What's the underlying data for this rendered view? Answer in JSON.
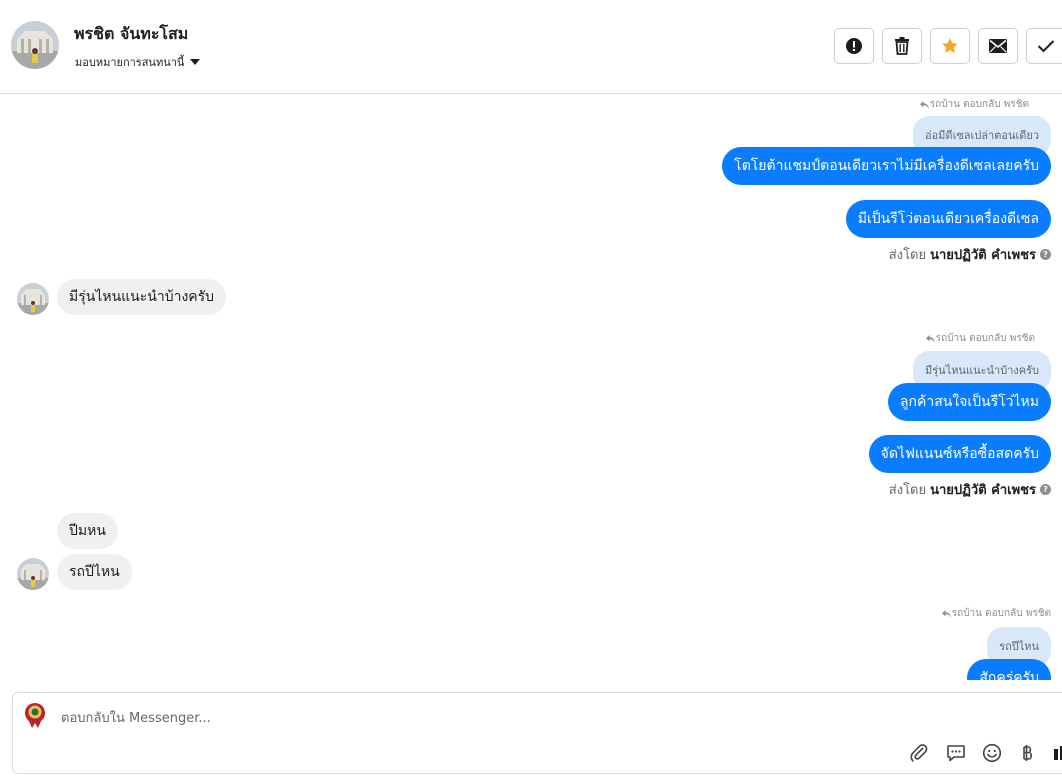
{
  "header": {
    "contact_name": "พรชิต จันทะโสม",
    "assign_label": "มอบหมายการสนทนานี้",
    "actions": [
      "mark-spam",
      "delete",
      "star",
      "mark-unread",
      "done"
    ],
    "star_color": "#f5a623"
  },
  "messages": {
    "reply1": {
      "meta": "รถบ้าน ตอบกลับ พรชิต",
      "quoted": "อ่อมีดีเซลเปล่าตอนเดียว",
      "bubbles": [
        "โตโยต้าแชมป์ตอนเดียวเราไม่มีเครื่องดีเซลเลยครับ",
        "มีเป็นรีโว่ตอนเดียวเครื่องดีเซล"
      ],
      "sent_prefix": "ส่งโดย",
      "sent_by": "นายปฏิวัติ คำเพชร"
    },
    "incoming1": "มีรุ่นไหนแนะนำบ้างครับ",
    "reply2": {
      "meta": "รถบ้าน ตอบกลับ พรชิต",
      "quoted": "มีรุ่นไหนแนะนำบ้างครับ",
      "bubbles": [
        "ลูกค้าสนใจเป็นรีโว่ไหม",
        "จัดไฟแนนซ์หรือซื้อสดครับ"
      ],
      "sent_prefix": "ส่งโดย",
      "sent_by": "นายปฏิวัติ คำเพชร"
    },
    "incoming2": [
      "ปีมหน",
      "รถปีไหน"
    ],
    "reply3": {
      "meta": "รถบ้าน ตอบกลับ พรชิต",
      "quoted": "รถปีไหน",
      "bubble": "สักครู่ครับ"
    }
  },
  "composer": {
    "placeholder": "ตอบกลับใน Messenger...",
    "tools": [
      "attachment-icon",
      "chat-bubble-icon",
      "emoji-icon",
      "baht-icon",
      "more-icon"
    ]
  },
  "colors": {
    "outgoing_bubble": "#0a7cff",
    "quoted_bubble": "#d9e7fb",
    "incoming_bubble": "#f0f0f0"
  }
}
